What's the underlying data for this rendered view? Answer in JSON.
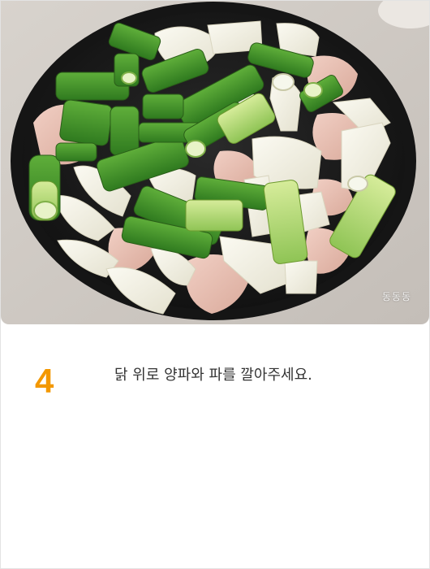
{
  "step": {
    "number": "4",
    "text": "닭 위로 양파와 파를 깔아주세요."
  },
  "photo": {
    "watermark": "동동동"
  },
  "colors": {
    "step_number": "#f39800",
    "step_text": "#333333",
    "pan": "#1d1d1d",
    "counter": "#cfc9c2"
  }
}
